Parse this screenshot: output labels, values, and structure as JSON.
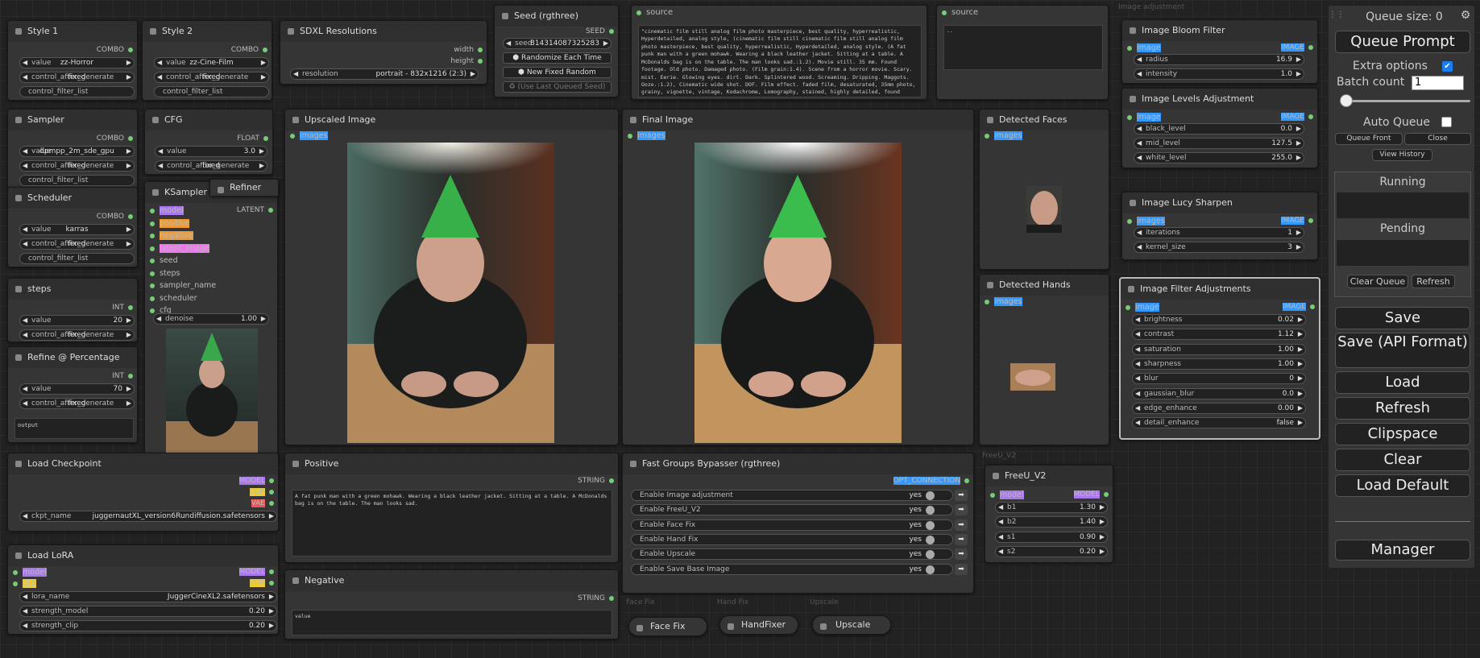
{
  "style1": {
    "title": "Style 1",
    "out": "COMBO",
    "value_label": "value",
    "value": "zz-Horror",
    "cag_label": "control_after_generate",
    "cag": "fixed",
    "filter": "control_filter_list"
  },
  "style2": {
    "title": "Style 2",
    "out": "COMBO",
    "value_label": "value",
    "value": "zz-Cine-Film",
    "cag_label": "control_after_generate",
    "cag": "fixed",
    "filter": "control_filter_list"
  },
  "sdxl": {
    "title": "SDXL Resolutions",
    "out1": "width",
    "out2": "height",
    "res_label": "resolution",
    "res": "portrait - 832x1216 (2:3)"
  },
  "seed": {
    "title": "Seed (rgthree)",
    "out": "SEED",
    "seed_label": "seed",
    "seed_value": "814314087325283",
    "b1": "Randomize Each Time",
    "b2": "New Fixed Random",
    "b3": "(Use Last Queued Seed)"
  },
  "source1": {
    "title": "source",
    "text": "\"cinematic film still analog film photo masterpiece, best quality, hyperrealistic, Hyperdetailed, analog style, (cinematic film still cinematic film still analog film photo masterpiece, best quality, hyperrealistic, Hyperdetailed, analog style. (A fat punk man with a green mohawk. Wearing a black leather jacket. Sitting at a table. A McDonalds bag is on the table. The man looks sad.:1.2). Movie still. 35 mm. Found footage. Old photo. Damaged photo. (Film grain:1.4). Scene from a horror movie. Scary. mist. Eerie. Glowing eyes. dirt. Dark. Splintered wood. Screaming. Dripping. Maggots. Ooze.:1.2), Cinematic wide shot. DOF. Film effect. faded film, desaturated, 35mm photo, grainy, vignette, vintage, Kodachrome, Lomography, stained, highly detailed, found footage , shallow depth"
  },
  "source2": {
    "title": "source",
    "text": "--"
  },
  "sampler": {
    "title": "Sampler",
    "out": "COMBO",
    "value_label": "value",
    "value": "dpmpp_2m_sde_gpu",
    "cag_label": "control_after_generate",
    "cag": "fixed",
    "filter": "control_filter_list"
  },
  "scheduler": {
    "title": "Scheduler",
    "out": "COMBO",
    "value_label": "value",
    "value": "karras",
    "cag_label": "control_after_generate",
    "cag": "fixed",
    "filter": "control_filter_list"
  },
  "cfg": {
    "title": "CFG",
    "out": "FLOAT",
    "value_label": "value",
    "value": "3.0",
    "cag_label": "control_after_generate",
    "cag": "fixed"
  },
  "steps": {
    "title": "steps",
    "out": "INT",
    "value_label": "value",
    "value": "20",
    "cag_label": "control_after_generate",
    "cag": "fixed"
  },
  "refine": {
    "title": "Refine @ Percentage",
    "out": "INT",
    "value_label": "value",
    "value": "70",
    "cag_label": "control_after_generate",
    "cag": "fixed",
    "output": "output"
  },
  "ksampler": {
    "title": "KSampler",
    "out": "LATENT",
    "inputs": [
      "model",
      "positive",
      "negative",
      "latent_image",
      "seed",
      "steps",
      "sampler_name",
      "scheduler",
      "cfg"
    ],
    "denoise_label": "denoise",
    "denoise": "1.00"
  },
  "refiner": {
    "title": "Refiner"
  },
  "upscaled": {
    "title": "Upscaled Image",
    "in": "images"
  },
  "final": {
    "title": "Final Image",
    "in": "images"
  },
  "faces": {
    "title": "Detected Faces",
    "in": "images"
  },
  "hands": {
    "title": "Detected Hands",
    "in": "images"
  },
  "group_img_adj": "Image adjustment",
  "bloom": {
    "title": "Image Bloom Filter",
    "in": "image",
    "out": "IMAGE",
    "radius_label": "radius",
    "radius": "16.9",
    "intensity_label": "intensity",
    "intensity": "1.0"
  },
  "levels": {
    "title": "Image Levels Adjustment",
    "in": "image",
    "out": "IMAGE",
    "bl_label": "black_level",
    "bl": "0.0",
    "ml_label": "mid_level",
    "ml": "127.5",
    "wl_label": "white_level",
    "wl": "255.0"
  },
  "lucy": {
    "title": "Image Lucy Sharpen",
    "in": "images",
    "out": "IMAGE",
    "it_label": "iterations",
    "it": "1",
    "ks_label": "kernel_size",
    "ks": "3"
  },
  "filter": {
    "title": "Image Filter Adjustments",
    "in": "image",
    "out": "IMAGE",
    "rows": [
      [
        "brightness",
        "0.02"
      ],
      [
        "contrast",
        "1.12"
      ],
      [
        "saturation",
        "1.00"
      ],
      [
        "sharpness",
        "1.00"
      ],
      [
        "blur",
        "0"
      ],
      [
        "gaussian_blur",
        "0.0"
      ],
      [
        "edge_enhance",
        "0.00"
      ],
      [
        "detail_enhance",
        "false"
      ]
    ]
  },
  "ckpt": {
    "title": "Load Checkpoint",
    "o1": "MODEL",
    "o2": "CLIP",
    "o3": "VAE",
    "label": "ckpt_name",
    "value": "juggernautXL_version6Rundiffusion.safetensors"
  },
  "lora": {
    "title": "Load LoRA",
    "i1": "model",
    "i2": "clip",
    "o1": "MODEL",
    "o2": "CLIP",
    "name_label": "lora_name",
    "name": "JuggerCineXL2.safetensors",
    "sm_label": "strength_model",
    "sm": "0.20",
    "sc_label": "strength_clip",
    "sc": "0.20"
  },
  "positive": {
    "title": "Positive",
    "out": "STRING",
    "text": "A fat punk man with a green mohawk. Wearing a black leather jacket. Sitting at a table. A McDonalds bag is on the table. The man looks sad."
  },
  "negative": {
    "title": "Negative",
    "out": "STRING",
    "text": "value"
  },
  "bypasser": {
    "title": "Fast Groups Bypasser (rgthree)",
    "out": "OPT_CONNECTION",
    "rows": [
      "Enable Image adjustment",
      "Enable FreeU_V2",
      "Enable Face Fix",
      "Enable Hand Fix",
      "Enable Upscale",
      "Enable Save Base Image"
    ],
    "yes": "yes"
  },
  "group_freeu": "FreeU_V2",
  "freeu": {
    "title": "FreeU_V2",
    "in": "model",
    "out": "MODEL",
    "rows": [
      [
        "b1",
        "1.30"
      ],
      [
        "b2",
        "1.40"
      ],
      [
        "s1",
        "0.90"
      ],
      [
        "s2",
        "0.20"
      ]
    ]
  },
  "group_face": "Face Fix",
  "group_hand": "Hand Fix",
  "group_up": "Upscale",
  "facefix": {
    "title": "Face Fix"
  },
  "handfix": {
    "title": "HandFixer"
  },
  "upscale": {
    "title": "Upscale"
  },
  "panel": {
    "queue_size": "Queue size: 0",
    "queue_prompt": "Queue Prompt",
    "extra_options": "Extra options",
    "batch_count_label": "Batch count",
    "batch_count": "1",
    "auto_queue": "Auto Queue",
    "queue_front": "Queue Front",
    "close": "Close",
    "view_history": "View History",
    "running": "Running",
    "pending": "Pending",
    "clear_queue": "Clear Queue",
    "refresh_small": "Refresh",
    "buttons": [
      "Save",
      "Save (API Format)",
      "Load",
      "Refresh",
      "Clipspace",
      "Clear",
      "Load Default"
    ],
    "manager": "Manager"
  }
}
